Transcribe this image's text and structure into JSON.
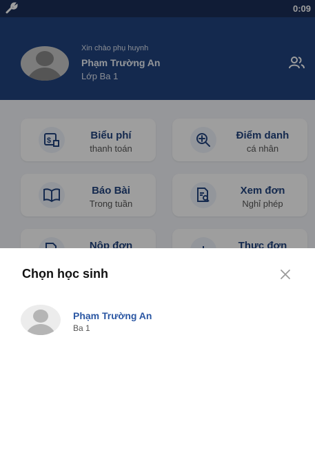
{
  "status_bar": {
    "time": "0:09"
  },
  "header": {
    "greeting": "Xin chào phụ huynh",
    "parent_name": "Phạm Trường An",
    "class_name": "Lớp Ba 1"
  },
  "menu": [
    {
      "title": "Biểu phí",
      "subtitle": "thanh toán",
      "icon": "fee-icon"
    },
    {
      "title": "Điểm danh",
      "subtitle": "cá nhân",
      "icon": "zoom-plus-icon"
    },
    {
      "title": "Báo Bài",
      "subtitle": "Trong tuần",
      "icon": "book-icon"
    },
    {
      "title": "Xem đơn",
      "subtitle": "Nghỉ phép",
      "icon": "document-search-icon"
    },
    {
      "title": "Nộp đơn",
      "subtitle": "",
      "icon": "submit-form-icon"
    },
    {
      "title": "Thực đơn",
      "subtitle": "",
      "icon": "menu-food-icon"
    }
  ],
  "sheet": {
    "title": "Chọn học sinh",
    "students": [
      {
        "name": "Phạm Trường An",
        "class": "Ba 1"
      }
    ]
  },
  "colors": {
    "header": "#21437e",
    "status_bar": "#1b2e58",
    "accent": "#2b57a3"
  }
}
